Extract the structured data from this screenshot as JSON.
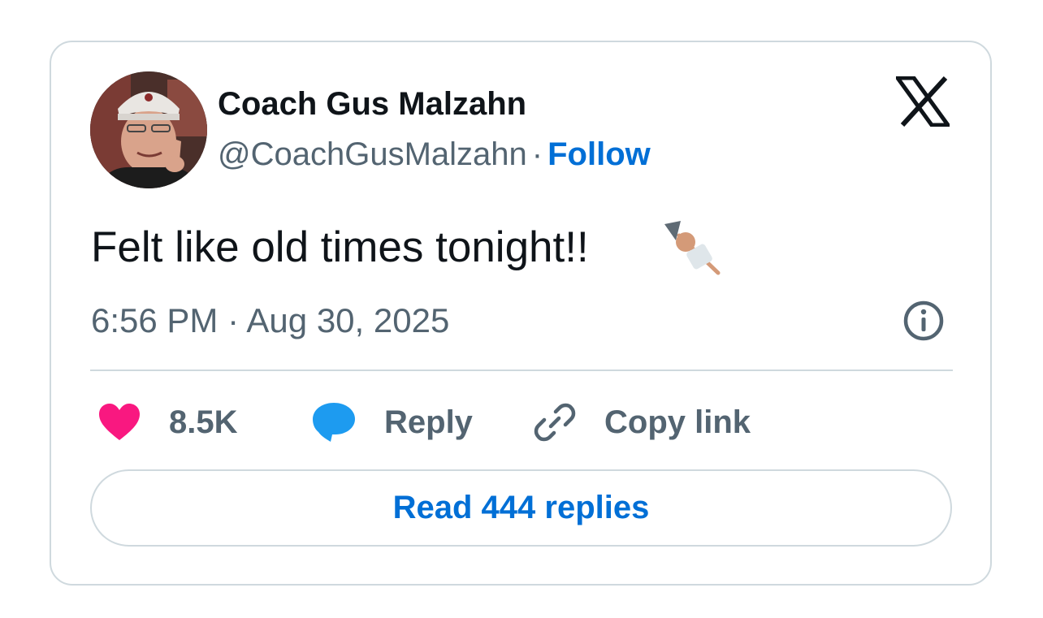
{
  "tweet": {
    "author": {
      "display_name": "Coach Gus Malzahn",
      "handle": "@CoachGusMalzahn",
      "separator": "·",
      "follow_label": "Follow"
    },
    "text": "Felt like old times tonight!!",
    "emoji": "oden-icon",
    "timestamp": "6:56 PM · Aug 30, 2025",
    "actions": {
      "likes_count": "8.5K",
      "reply_label": "Reply",
      "copy_link_label": "Copy link"
    },
    "read_replies_label": "Read 444 replies"
  },
  "colors": {
    "link_blue": "#006fd6",
    "heart_pink": "#f91880",
    "reply_blue": "#1d9bf0",
    "secondary_text": "#536471",
    "border": "#cfd9de"
  }
}
